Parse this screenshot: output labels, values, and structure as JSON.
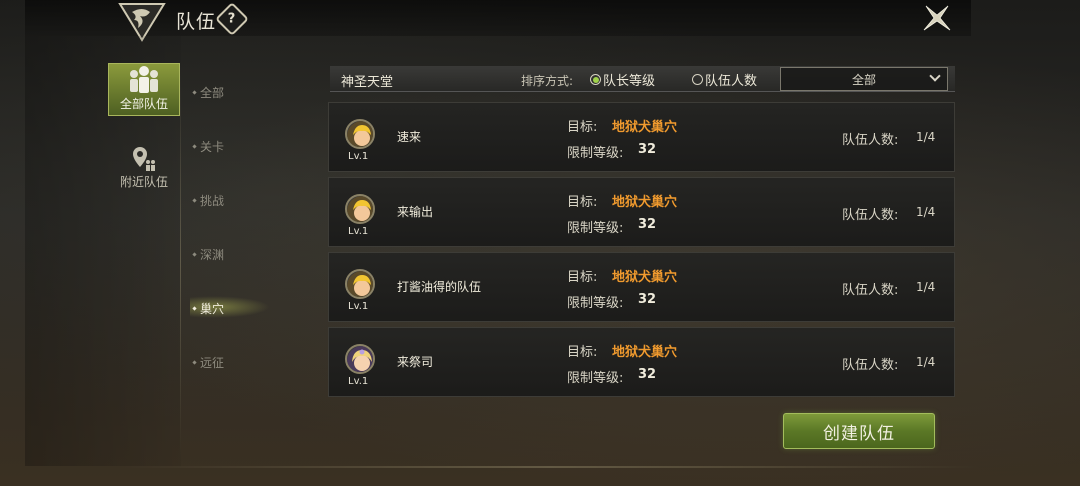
{
  "header": {
    "title": "队伍",
    "help_glyph": "?",
    "icons": [
      "dragon-emblem-icon",
      "help-icon",
      "close-icon"
    ]
  },
  "sidebar": {
    "primary": [
      {
        "label": "全部队伍",
        "icon": "group-icon",
        "active": true
      },
      {
        "label": "附近队伍",
        "icon": "location-people-icon",
        "active": false
      }
    ],
    "categories": [
      {
        "label": "全部",
        "active": false
      },
      {
        "label": "关卡",
        "active": false
      },
      {
        "label": "挑战",
        "active": false
      },
      {
        "label": "深渊",
        "active": false
      },
      {
        "label": "巢穴",
        "active": true
      },
      {
        "label": "远征",
        "active": false
      }
    ]
  },
  "filter": {
    "zone": "神圣天堂",
    "sort_label": "排序方式:",
    "sort_options": [
      {
        "label": "队长等级",
        "selected": true
      },
      {
        "label": "队伍人数",
        "selected": false
      }
    ],
    "select_value": "全部"
  },
  "teams": [
    {
      "avatar": "blonde-hero",
      "level": "Lv.1",
      "name": "速来",
      "target_label": "目标:",
      "target": "地狱犬巢穴",
      "limit_label": "限制等级:",
      "limit": "32",
      "count_label": "队伍人数:",
      "count": "1/4"
    },
    {
      "avatar": "blonde-hero",
      "level": "Lv.1",
      "name": "来输出",
      "target_label": "目标:",
      "target": "地狱犬巢穴",
      "limit_label": "限制等级:",
      "limit": "32",
      "count_label": "队伍人数:",
      "count": "1/4"
    },
    {
      "avatar": "blonde-hero",
      "level": "Lv.1",
      "name": "打酱油得的队伍",
      "target_label": "目标:",
      "target": "地狱犬巢穴",
      "limit_label": "限制等级:",
      "limit": "32",
      "count_label": "队伍人数:",
      "count": "1/4"
    },
    {
      "avatar": "priest-girl",
      "level": "Lv.1",
      "name": "来祭司",
      "target_label": "目标:",
      "target": "地狱犬巢穴",
      "limit_label": "限制等级:",
      "limit": "32",
      "count_label": "队伍人数:",
      "count": "1/4"
    }
  ],
  "actions": {
    "create_team": "创建队伍"
  },
  "colors": {
    "accent_green": "#5b7826",
    "target_orange": "#f09a2e",
    "radio_selected": "#9fd24a"
  }
}
